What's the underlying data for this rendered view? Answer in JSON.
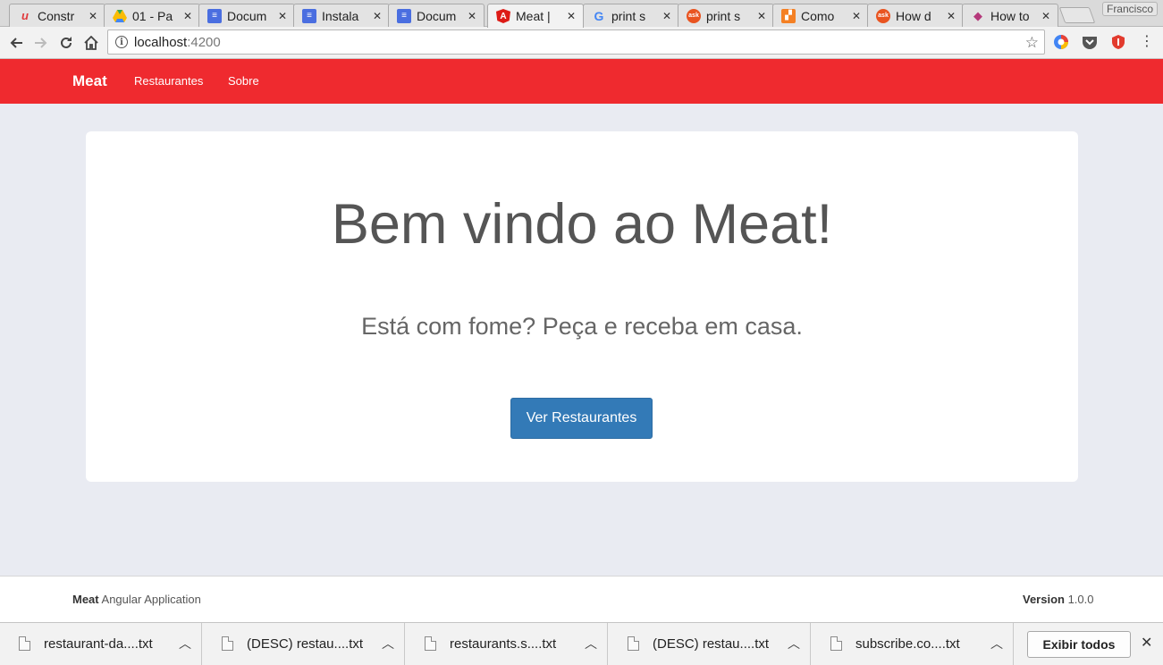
{
  "browser": {
    "tabs": [
      {
        "title": "Constr",
        "icon": "udemy-icon",
        "active": false
      },
      {
        "title": "01 - Pa",
        "icon": "google-drive-icon",
        "active": false
      },
      {
        "title": "Docum",
        "icon": "google-docs-icon",
        "active": false
      },
      {
        "title": "Instala",
        "icon": "google-docs-icon",
        "active": false
      },
      {
        "title": "Docum",
        "icon": "google-docs-icon",
        "active": false
      },
      {
        "title": "Meat |",
        "icon": "angular-icon",
        "active": true
      },
      {
        "title": "print s",
        "icon": "google-icon",
        "active": false
      },
      {
        "title": "print s",
        "icon": "askubuntu-icon",
        "active": false
      },
      {
        "title": "Como",
        "icon": "stackoverflow-icon",
        "active": false
      },
      {
        "title": "How d",
        "icon": "askubuntu-icon",
        "active": false
      },
      {
        "title": "How to",
        "icon": "graduation-cap-icon",
        "active": false
      }
    ],
    "profile_name": "Francisco",
    "url_host": "localhost",
    "url_port": ":4200",
    "info_glyph": "i"
  },
  "navbar": {
    "brand": "Meat",
    "links": [
      "Restaurantes",
      "Sobre"
    ],
    "color": "#ef2a2f"
  },
  "jumbotron": {
    "heading": "Bem vindo ao Meat!",
    "lead": "Está com fome? Peça e receba em casa.",
    "button_label": "Ver Restaurantes",
    "button_color": "#337ab7"
  },
  "footer": {
    "brand": "Meat",
    "tagline": " Angular Application",
    "version_label": "Version",
    "version_value": " 1.0.0"
  },
  "downloads": {
    "items": [
      "restaurant-da....txt",
      "(DESC) restau....txt",
      "restaurants.s....txt",
      "(DESC) restau....txt",
      "subscribe.co....txt"
    ],
    "show_all_label": "Exibir todos"
  }
}
